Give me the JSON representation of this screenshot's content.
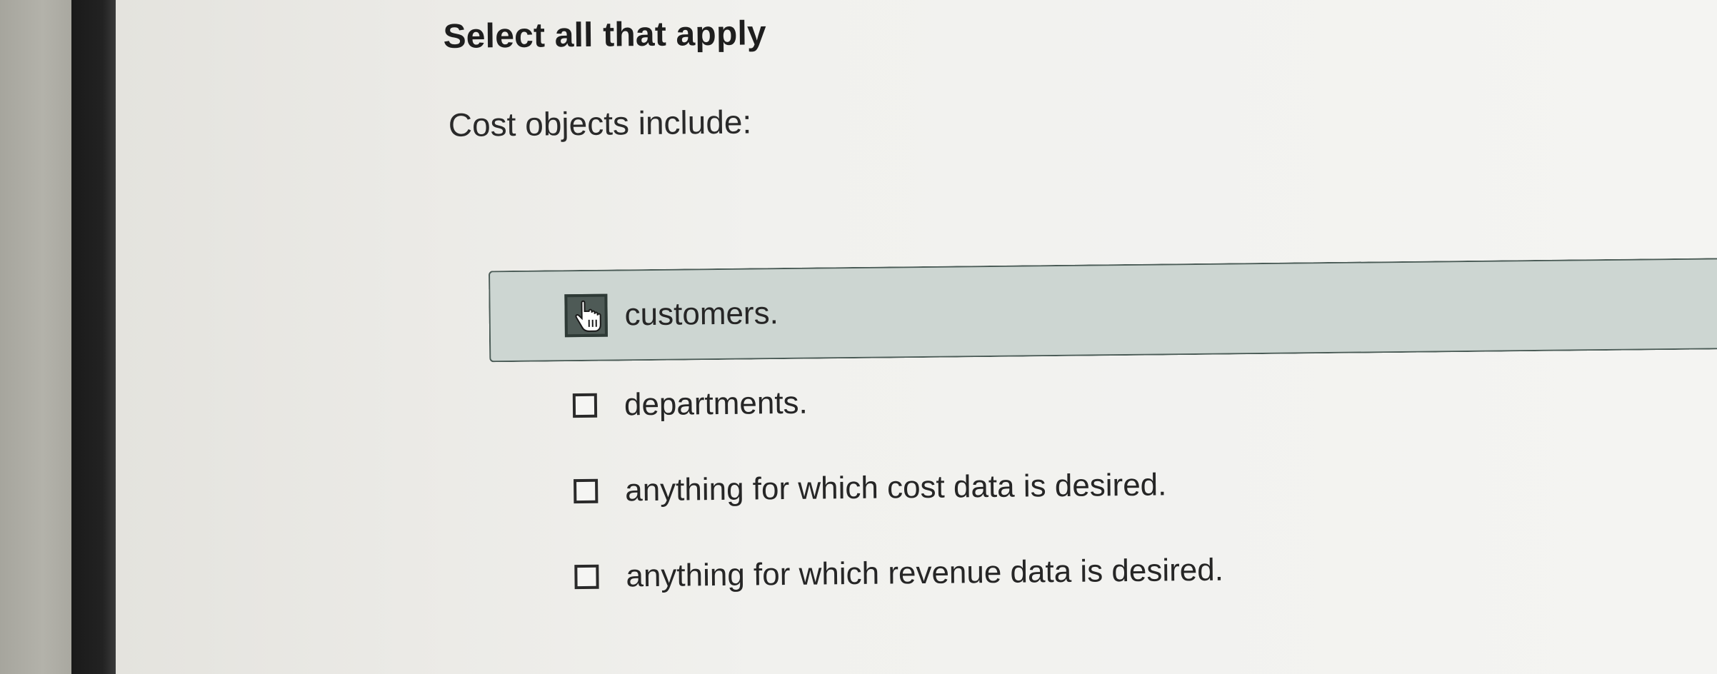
{
  "question": {
    "instruction": "Select all that apply",
    "prompt": "Cost objects include:"
  },
  "options": [
    {
      "label": "customers.",
      "checked": false,
      "hovered": true
    },
    {
      "label": "departments.",
      "checked": false,
      "hovered": false
    },
    {
      "label": "anything for which cost data is desired.",
      "checked": false,
      "hovered": false
    },
    {
      "label": "anything for which revenue data is desired.",
      "checked": false,
      "hovered": false
    }
  ],
  "cursor": {
    "icon": "hand-pointer-icon"
  },
  "colors": {
    "hover_background": "#cdd6d2",
    "hover_border": "#4a5b56",
    "text": "#262626"
  }
}
